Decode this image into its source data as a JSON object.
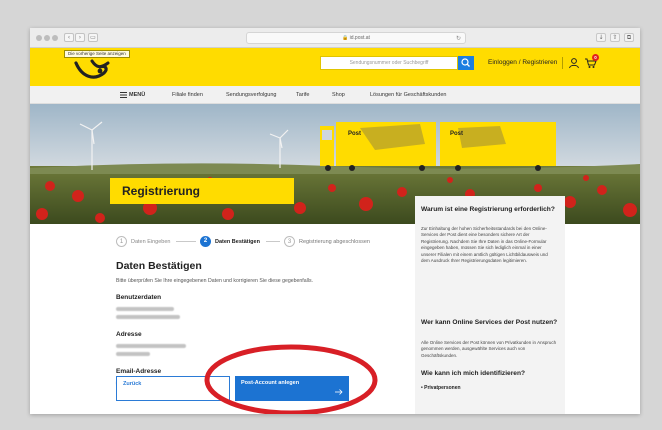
{
  "browser": {
    "url": "id.post.at"
  },
  "header": {
    "tooltip": "Die vorherige Seite anzeigen",
    "search_placeholder": "Sendungsnummer oder Suchbegriff",
    "login_label": "Einloggen / Registrieren",
    "cart_count": "0",
    "colors": {
      "brand_yellow": "#ffdc00",
      "accent_blue": "#1c73d2",
      "badge_red": "#e2231a"
    }
  },
  "nav": {
    "items": [
      "MENÜ",
      "Filiale finden",
      "Sendungsverfolgung",
      "Tarife",
      "Shop",
      "Lösungen für Geschäftskunden"
    ]
  },
  "hero": {
    "title": "Registrierung",
    "truck_brand": "Post"
  },
  "steps": [
    {
      "num": "1",
      "label": "Daten Eingeben",
      "state": "done"
    },
    {
      "num": "2",
      "label": "Daten Bestätigen",
      "state": "active"
    },
    {
      "num": "3",
      "label": "Registrierung abgeschlossen",
      "state": "pending"
    }
  ],
  "form": {
    "title": "Daten Bestätigen",
    "description": "Bitte überprüfen Sie Ihre eingegebenen Daten und korrigieren Sie diese gegebenfalls.",
    "sections": {
      "benutzerdaten": "Benutzerdaten",
      "adresse": "Adresse",
      "email": "Email-Adresse"
    },
    "back_label": "Zurück",
    "submit_label": "Post-Account anlegen"
  },
  "sidebar": {
    "h1": "Warum ist eine Registrierung erforderlich?",
    "p1": "Zur Einhaltung der hohen Sicherheitsstandards bei den Online-Services der Post dient eine besonders sichere Art der Registrierung. Nachdem Sie Ihre Daten in das Online-Formular eingegeben haben, müssen Sie sich lediglich einmal in einer unserer Filialen mit einem amtlich gültigen Lichtbildausweis und dem Ausdruck Ihrer Registrierungsdaten legitimieren.",
    "h2": "Wer kann Online Services der Post nutzen?",
    "p2": "Alle Online Services der Post können von Privatkunden in Anspruch genommen werden, ausgewählte Services auch von Geschäftskunden.",
    "h3": "Wie kann ich mich identifizieren?",
    "bullet1": "Privatpersonen"
  }
}
